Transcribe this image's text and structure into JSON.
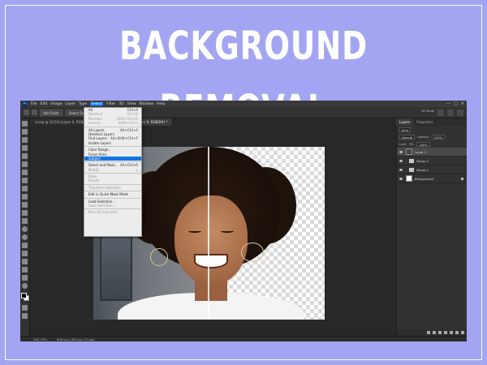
{
  "headline": "BACKGROUND REMOVAL",
  "app": {
    "logo": "Ps",
    "menus": [
      "File",
      "Edit",
      "Image",
      "Layer",
      "Type",
      "Select",
      "Filter",
      "3D",
      "View",
      "Window",
      "Help"
    ],
    "active_menu_index": 5,
    "window_controls": [
      "—",
      "□",
      "✕"
    ]
  },
  "options_bar": {
    "mode_box": "Add Subtr",
    "tool_label": "Select Subject",
    "right_label": "3D Mode"
  },
  "doc_tabs": [
    "Lorap @ 34.5% (Layer 0, RGB/8#) *",
    "Untitled-1 @ 164% (Layer 0, RGB/8#) *"
  ],
  "select_menu": {
    "items": [
      {
        "label": "All",
        "shortcut": "Ctrl+A",
        "state": "normal"
      },
      {
        "label": "Deselect",
        "shortcut": "Ctrl+D",
        "state": "dim"
      },
      {
        "label": "Reselect",
        "shortcut": "Shift+Ctrl+D",
        "state": "dim"
      },
      {
        "label": "Inverse",
        "shortcut": "Shift+Ctrl+I",
        "state": "dim"
      },
      {
        "sep": true
      },
      {
        "label": "All Layers",
        "shortcut": "Alt+Ctrl+A",
        "state": "normal"
      },
      {
        "label": "Deselect Layers",
        "shortcut": "",
        "state": "normal"
      },
      {
        "label": "Find Layers",
        "shortcut": "Alt+Shift+Ctrl+F",
        "state": "normal"
      },
      {
        "label": "Isolate Layers",
        "shortcut": "",
        "state": "normal"
      },
      {
        "sep": true
      },
      {
        "label": "Color Range...",
        "shortcut": "",
        "state": "normal"
      },
      {
        "label": "Focus Area...",
        "shortcut": "",
        "state": "normal"
      },
      {
        "label": "Subject",
        "shortcut": "",
        "state": "highlight"
      },
      {
        "sep": true
      },
      {
        "label": "Select and Mask...",
        "shortcut": "Alt+Ctrl+R",
        "state": "normal"
      },
      {
        "label": "Modify",
        "shortcut": "▸",
        "state": "dim"
      },
      {
        "sep": true
      },
      {
        "label": "Grow",
        "shortcut": "",
        "state": "dim"
      },
      {
        "label": "Similar",
        "shortcut": "",
        "state": "dim"
      },
      {
        "sep": true
      },
      {
        "label": "Transform Selection",
        "shortcut": "",
        "state": "dim"
      },
      {
        "sep": true
      },
      {
        "label": "Edit in Quick Mask Mode",
        "shortcut": "",
        "state": "normal"
      },
      {
        "sep": true
      },
      {
        "label": "Load Selection...",
        "shortcut": "",
        "state": "normal"
      },
      {
        "label": "Save Selection...",
        "shortcut": "",
        "state": "dim"
      },
      {
        "sep": true
      },
      {
        "label": "New 3D Extrusion",
        "shortcut": "",
        "state": "dim"
      }
    ]
  },
  "panel": {
    "tabs": [
      "Layers",
      "Properties"
    ],
    "kind_label": "Kind",
    "blend_mode": "Normal",
    "opacity_label": "Opacity:",
    "opacity_value": "100%",
    "lock_label": "Lock:",
    "fill_label": "Fill:",
    "fill_value": "100%",
    "layers": [
      {
        "name": "Layer 1",
        "type": "face",
        "selected": true
      },
      {
        "name": "Group 2",
        "type": "folder",
        "selected": false
      },
      {
        "name": "Group 1",
        "type": "folder",
        "selected": false
      },
      {
        "name": "Background",
        "type": "white",
        "selected": false,
        "locked": true
      }
    ]
  },
  "status": {
    "zoom": "163.73%",
    "doc_info": "600 px x 450 px (72 ppi)"
  }
}
